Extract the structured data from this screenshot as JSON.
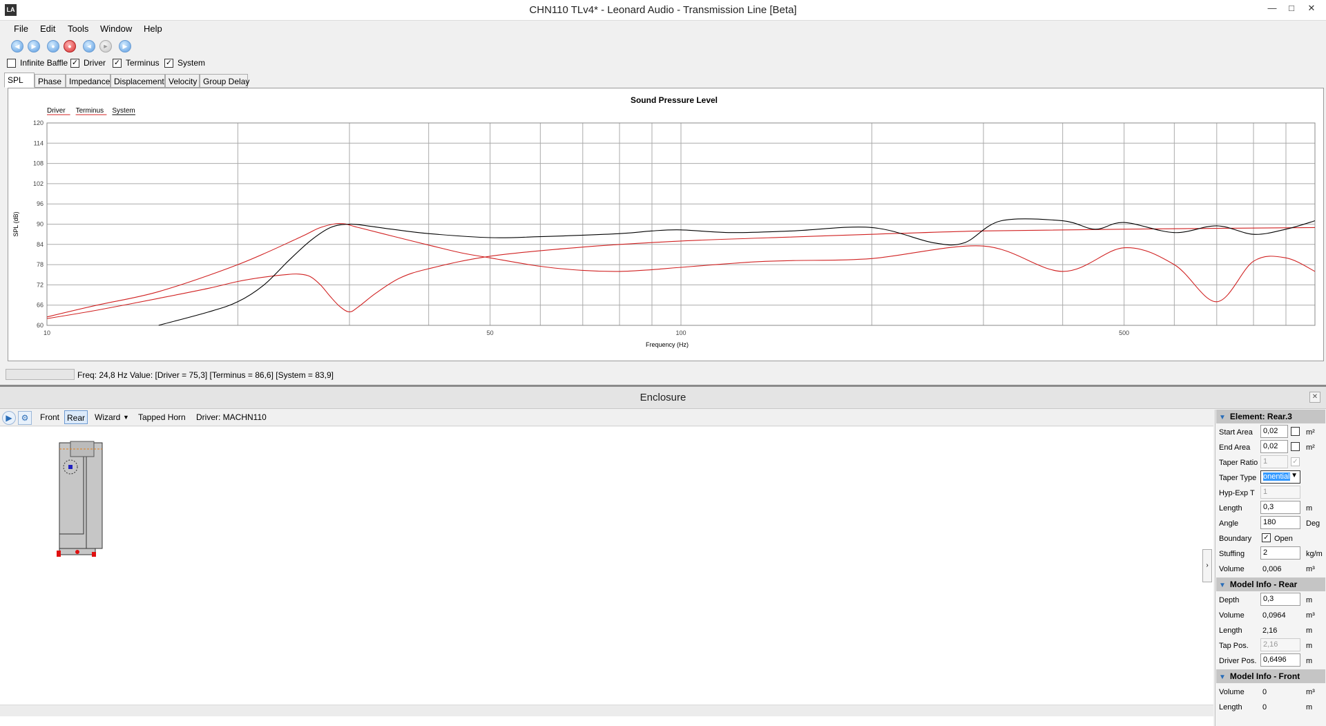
{
  "window": {
    "title": "CHN110 TLv4* - Leonard Audio - Transmission Line [Beta]",
    "app_icon": "LA"
  },
  "menu": [
    "File",
    "Edit",
    "Tools",
    "Window",
    "Help"
  ],
  "toolbar_icons": [
    "rewind-icon",
    "fast-forward-icon",
    "record-stop-icon",
    "record-icon",
    "step-back-icon",
    "step-forward-icon",
    "play-icon"
  ],
  "checks": [
    {
      "label": "Infinite Baffle",
      "checked": false
    },
    {
      "label": "Driver",
      "checked": true
    },
    {
      "label": "Terminus",
      "checked": true
    },
    {
      "label": "System",
      "checked": true
    }
  ],
  "tabs": [
    "SPL",
    "Phase",
    "Impedance",
    "Displacement",
    "Velocity",
    "Group Delay"
  ],
  "active_tab": "SPL",
  "chart_data": {
    "type": "line",
    "title": "Sound Pressure Level",
    "xlabel": "Frequency (Hz)",
    "ylabel": "SPL (dB)",
    "x_scale": "log",
    "xlim": [
      10,
      1000
    ],
    "ylim": [
      60,
      120
    ],
    "yticks": [
      "60",
      "66",
      "72",
      "78",
      "84",
      "90",
      "96",
      "102",
      "108",
      "114",
      "120"
    ],
    "xticks": [
      "10",
      "50",
      "100",
      "500"
    ],
    "grid": true,
    "legend_placement": "top-left",
    "series": [
      {
        "name": "Driver",
        "color": "#d02020",
        "points": [
          [
            10,
            62.5
          ],
          [
            12,
            66
          ],
          [
            15,
            70
          ],
          [
            20,
            78
          ],
          [
            25,
            86
          ],
          [
            27,
            89
          ],
          [
            29,
            90.2
          ],
          [
            31,
            89
          ],
          [
            35,
            86.5
          ],
          [
            40,
            83.8
          ],
          [
            45,
            81.5
          ],
          [
            50,
            80
          ],
          [
            60,
            77.5
          ],
          [
            70,
            76.3
          ],
          [
            80,
            76
          ],
          [
            90,
            76.5
          ],
          [
            100,
            77.2
          ],
          [
            130,
            78.8
          ],
          [
            150,
            79.2
          ],
          [
            200,
            79.8
          ],
          [
            300,
            83.5
          ],
          [
            400,
            76
          ],
          [
            500,
            83
          ],
          [
            600,
            78
          ],
          [
            700,
            67
          ],
          [
            800,
            79
          ],
          [
            900,
            80
          ],
          [
            1000,
            76
          ]
        ]
      },
      {
        "name": "Terminus",
        "color": "#d02020",
        "points": [
          [
            10,
            62
          ],
          [
            12,
            64.5
          ],
          [
            15,
            68
          ],
          [
            18,
            71
          ],
          [
            20,
            73
          ],
          [
            22,
            74.3
          ],
          [
            24,
            75.1
          ],
          [
            25,
            75.2
          ],
          [
            26,
            74.5
          ],
          [
            27,
            72
          ],
          [
            28,
            68.5
          ],
          [
            29,
            65.5
          ],
          [
            30,
            64
          ],
          [
            31,
            65.5
          ],
          [
            33,
            69.5
          ],
          [
            36,
            74
          ],
          [
            40,
            76.8
          ],
          [
            50,
            80.5
          ],
          [
            70,
            83.2
          ],
          [
            100,
            85
          ],
          [
            150,
            86.2
          ],
          [
            200,
            87
          ],
          [
            300,
            88
          ],
          [
            500,
            88.5
          ],
          [
            1000,
            89
          ]
        ]
      },
      {
        "name": "System",
        "color": "#000000",
        "points": [
          [
            15,
            60
          ],
          [
            18,
            64
          ],
          [
            20,
            67
          ],
          [
            22,
            72
          ],
          [
            24,
            79
          ],
          [
            26,
            85
          ],
          [
            28,
            89
          ],
          [
            30,
            90
          ],
          [
            32,
            89.5
          ],
          [
            35,
            88.5
          ],
          [
            40,
            87.2
          ],
          [
            50,
            86
          ],
          [
            60,
            86.3
          ],
          [
            80,
            87.2
          ],
          [
            90,
            88
          ],
          [
            100,
            88.3
          ],
          [
            120,
            87.5
          ],
          [
            150,
            88
          ],
          [
            200,
            89
          ],
          [
            250,
            84.5
          ],
          [
            280,
            84.5
          ],
          [
            320,
            91
          ],
          [
            400,
            91
          ],
          [
            450,
            88.5
          ],
          [
            500,
            90.5
          ],
          [
            600,
            87.5
          ],
          [
            700,
            89.5
          ],
          [
            800,
            87
          ],
          [
            900,
            88.5
          ],
          [
            1000,
            91
          ]
        ]
      }
    ]
  },
  "status": {
    "text": "Freq: 24,8 Hz   Value: [Driver = 75,3]  [Terminus = 86,6]  [System = 83,9]"
  },
  "enclosure": {
    "title": "Enclosure",
    "toolbar": {
      "front": "Front",
      "rear": "Rear",
      "wizard": "Wizard",
      "horn": "Tapped Horn",
      "driver": "Driver: MACHN110"
    },
    "sections": {
      "element": "Element: Rear.3",
      "model_rear": "Model Info - Rear",
      "model_front": "Model Info - Front"
    },
    "element": {
      "start_area": {
        "label": "Start Area",
        "value": "0,02",
        "unit": "m²"
      },
      "end_area": {
        "label": "End Area",
        "value": "0,02",
        "unit": "m²"
      },
      "taper_ratio": {
        "label": "Taper Ratio",
        "value": "1"
      },
      "taper_type": {
        "label": "Taper Type",
        "value": "onential"
      },
      "hyp_exp": {
        "label": "Hyp-Exp T",
        "value": "1"
      },
      "length": {
        "label": "Length",
        "value": "0,3",
        "unit": "m"
      },
      "angle": {
        "label": "Angle",
        "value": "180",
        "unit": "Deg"
      },
      "boundary": {
        "label": "Boundary",
        "value": "Open",
        "checked": true
      },
      "stuffing": {
        "label": "Stuffing",
        "value": "2",
        "unit": "kg/m"
      },
      "volume": {
        "label": "Volume",
        "value": "0,006",
        "unit": "m³"
      }
    },
    "rear": {
      "depth": {
        "label": "Depth",
        "value": "0,3",
        "unit": "m"
      },
      "volume": {
        "label": "Volume",
        "value": "0,0964",
        "unit": "m³"
      },
      "length": {
        "label": "Length",
        "value": "2,16",
        "unit": "m"
      },
      "tap_pos": {
        "label": "Tap Pos.",
        "value": "2,16",
        "unit": "m"
      },
      "driver_pos": {
        "label": "Driver Pos.",
        "value": "0,6496",
        "unit": "m"
      }
    },
    "front": {
      "volume": {
        "label": "Volume",
        "value": "0",
        "unit": "m³"
      },
      "length": {
        "label": "Length",
        "value": "0",
        "unit": "m"
      }
    }
  }
}
